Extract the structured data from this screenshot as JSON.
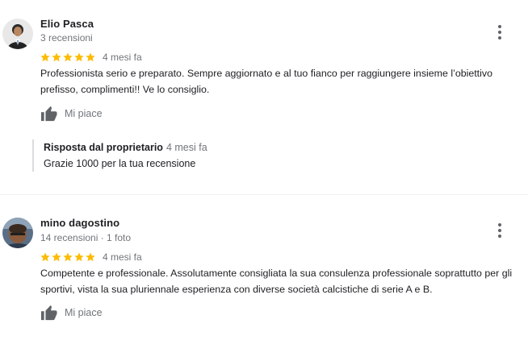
{
  "reviews": [
    {
      "author": "Elio Pasca",
      "meta": "3 recensioni",
      "rating": 5,
      "time": "4 mesi fa",
      "text": "Professionista serio e preparato. Sempre aggiornato e al tuo fianco per raggiungere insieme l’obiettivo prefisso, complimenti!! Ve lo consiglio.",
      "like_label": "Mi piace",
      "owner_reply": {
        "title": "Risposta dal proprietario",
        "time": "4 mesi fa",
        "text": "Grazie 1000 per la tua recensione"
      }
    },
    {
      "author": "mino dagostino",
      "meta": "14 recensioni · 1 foto",
      "rating": 5,
      "time": "4 mesi fa",
      "text": "Competente e professionale. Assolutamente consigliata la sua consulenza professionale soprattutto per gli sportivi, vista la sua pluriennale esperienza con diverse società calcistiche di serie A e B.",
      "like_label": "Mi piace"
    }
  ],
  "icons": {
    "star": "star-icon",
    "more": "more-vert-icon",
    "like": "thumb-up-icon"
  },
  "colors": {
    "star": "#fbbc04",
    "secondary_text": "#70757a",
    "primary_text": "#202124",
    "icon": "#5f6368",
    "reply_border": "#dadce0"
  }
}
